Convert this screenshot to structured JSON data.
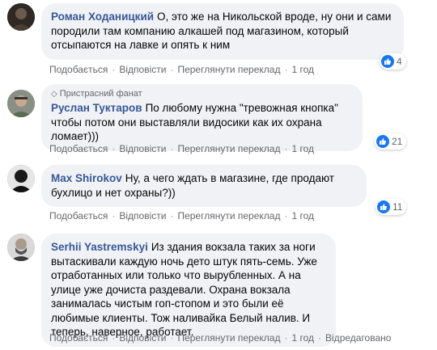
{
  "actions": {
    "like": "Подобається",
    "reply": "Відповісти",
    "translate": "Переглянути переклад",
    "separator": "·",
    "edited": "Відредаговано"
  },
  "comments": [
    {
      "author": "Роман Ходаницкий",
      "text": "О, это же на Никольской вроде, ну они и сами породили там компанию алкашей под магазином, который отсыпаются на лавке и опять к ним",
      "time": "1 год",
      "reactions": "4"
    },
    {
      "badge": "Пристрасний фанат",
      "author": "Руслан Туктаров",
      "text": "По любому нужна \"тревожная кнопка\" чтобы потом они выставляли видосики как их охрана ломает)))",
      "time": "1 год",
      "reactions": "21"
    },
    {
      "author": "Max Shirokov",
      "text": "Ну, а чего ждать в магазине, где продают бухлицо и нет охраны?))",
      "time": "1 год",
      "reactions": "11"
    },
    {
      "author": "Serhii Yastremskyi",
      "text": "Из здания вокзала таких за ноги вытаскивали каждую ночь дето штук пять-семь. Уже отработанных или только что вырубленных. А на улице уже дочиста раздевали. Охрана вокзала занималась чистым гоп-стопом и это были её любимые клиенты. Тож наливайка Белый налив. И теперь, наверное, работает.",
      "time": "1 год"
    }
  ]
}
